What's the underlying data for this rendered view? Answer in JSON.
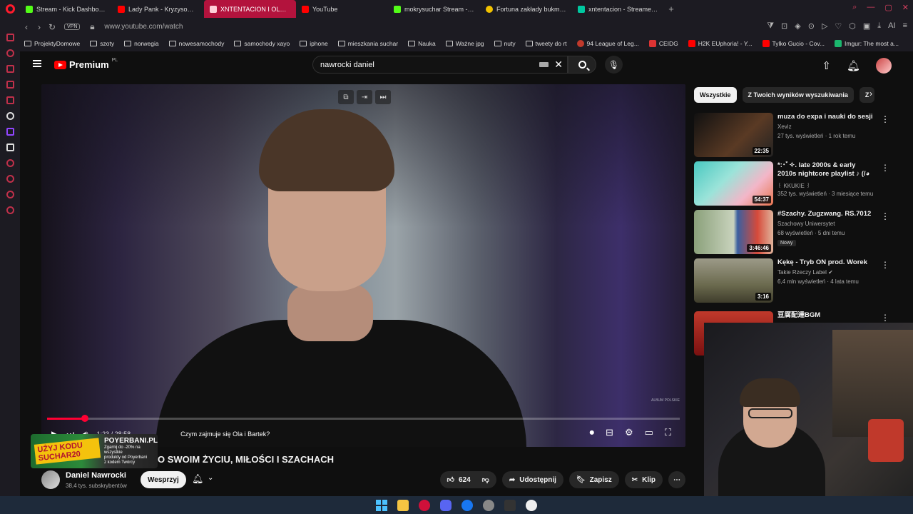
{
  "browser": {
    "tabs": [
      {
        "label": "Stream - Kick Dashboard",
        "color": "#53fc18"
      },
      {
        "label": "Lady Pank - Kryzysowa Narzeczona",
        "color": "#ff0000"
      },
      {
        "label": "XNTENTACION I OLACZKA",
        "color": "#ff4d6d"
      },
      {
        "label": "YouTube",
        "color": "#ff0000"
      },
      {
        "label": "mokrysuchar Stream - Watch",
        "color": "#53fc18"
      },
      {
        "label": "Fortuna zakłady bukmacherskie",
        "color": "#f2c200"
      },
      {
        "label": "xntentacion - Streamer Overview",
        "color": "#00c8a0"
      }
    ],
    "url": "www.youtube.com/watch",
    "vpn": "VPN",
    "ai_label": "AI",
    "bookmarks": [
      "ProjektyDomowe",
      "szoty",
      "norwegia",
      "nowesamochody",
      "samochody xayo",
      "iphone",
      "mieszkania suchar",
      "Nauka",
      "Ważne jpg",
      "nuty",
      "tweety do rt",
      "94 League of Leg...",
      "CEIDG",
      "H2K EUphoria! - Y...",
      "Tylko Gucio - Cov...",
      "Imgur: The most a..."
    ]
  },
  "youtube": {
    "brand": "Premium",
    "region": "PL",
    "search_value": "nawrocki daniel",
    "video": {
      "title": "O SWOIM ŻYCIU, MIŁOŚCI I SZACHACH",
      "chapter": "Czym zajmuje się Ola i Bartek?",
      "time": "1:23 / 28:58",
      "watermark": "ALBUM POLSKIE",
      "progress": 0.06
    },
    "ad": {
      "code": "UŻYJ KODU SUCHAR20",
      "brand": "POYERBANI.PL",
      "line1": "Zgarnij do -20% na wszystkie",
      "line2": "produkty od Poyerbani",
      "line3": "z kodem Twórcy"
    },
    "channel": {
      "name": "Daniel Nawrocki",
      "subs": "38,4 tys. subskrybentów",
      "support": "Wesprzyj"
    },
    "actions": {
      "likes": "624",
      "share": "Udostępnij",
      "save": "Zapisz",
      "clip": "Klip"
    },
    "chips": [
      "Wszystkie",
      "Z Twoich wyników wyszukiwania",
      "Z"
    ],
    "recommendations": [
      {
        "title": "muza do expa i nauki do sesji",
        "channel": "Xeviz",
        "meta": "27 tys. wyświetleń · 1 rok temu",
        "duration": "22:35",
        "thumb": "#3a2a22"
      },
      {
        "title": "*:･ﾟ✧. late 2000s & early 2010s nightcore playlist ♪ (/◕ヮ◕)/...",
        "channel": "꒰ KKUKIE ꒱",
        "meta": "352 tys. wyświetleń · 3 miesiące temu",
        "duration": "54:37",
        "thumb": "#3fb8b0"
      },
      {
        "title": "#Szachy. Zugzwang. RS.7012",
        "channel": "Szachowy Uniwersytet",
        "meta": "68 wyświetleń · 5 dni temu",
        "badge": "Nowy",
        "duration": "3:46:46",
        "thumb": "#5a6b55"
      },
      {
        "title": "Kękę - Tryb ON prod. Worek",
        "channel": "Takie Rzeczy Label ✔",
        "meta": "6,4 mln wyświetleń · 4 lata temu",
        "duration": "3:16",
        "thumb": "#6b6a4e"
      },
      {
        "title": "豆腐配達BGM",
        "channel": "",
        "meta": "",
        "duration": "",
        "thumb": "#a01818"
      }
    ]
  }
}
